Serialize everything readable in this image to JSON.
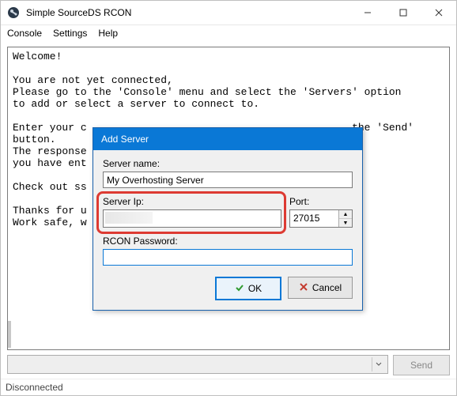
{
  "window": {
    "title": "Simple SourceDS RCON"
  },
  "menu": {
    "console": "Console",
    "settings": "Settings",
    "help": "Help"
  },
  "console_text": "Welcome!\n\nYou are not yet connected,\nPlease go to the 'Console' menu and select the 'Servers' option\nto add or select a server to connect to.\n\nEnter your c                                           the 'Send'\nbutton.\nThe response                                          ds\nyou have ent\n\nCheck out ss\n\nThanks for u\nWork safe, w",
  "input": {
    "send_label": "Send"
  },
  "status": {
    "text": "Disconnected"
  },
  "dialog": {
    "title": "Add Server",
    "server_name_label": "Server name:",
    "server_name_value": "My Overhosting Server",
    "server_ip_label": "Server Ip:",
    "server_ip_value": "",
    "port_label": "Port:",
    "port_value": "27015",
    "rcon_label": "RCON Password:",
    "rcon_value": "",
    "ok_label": "OK",
    "cancel_label": "Cancel"
  }
}
